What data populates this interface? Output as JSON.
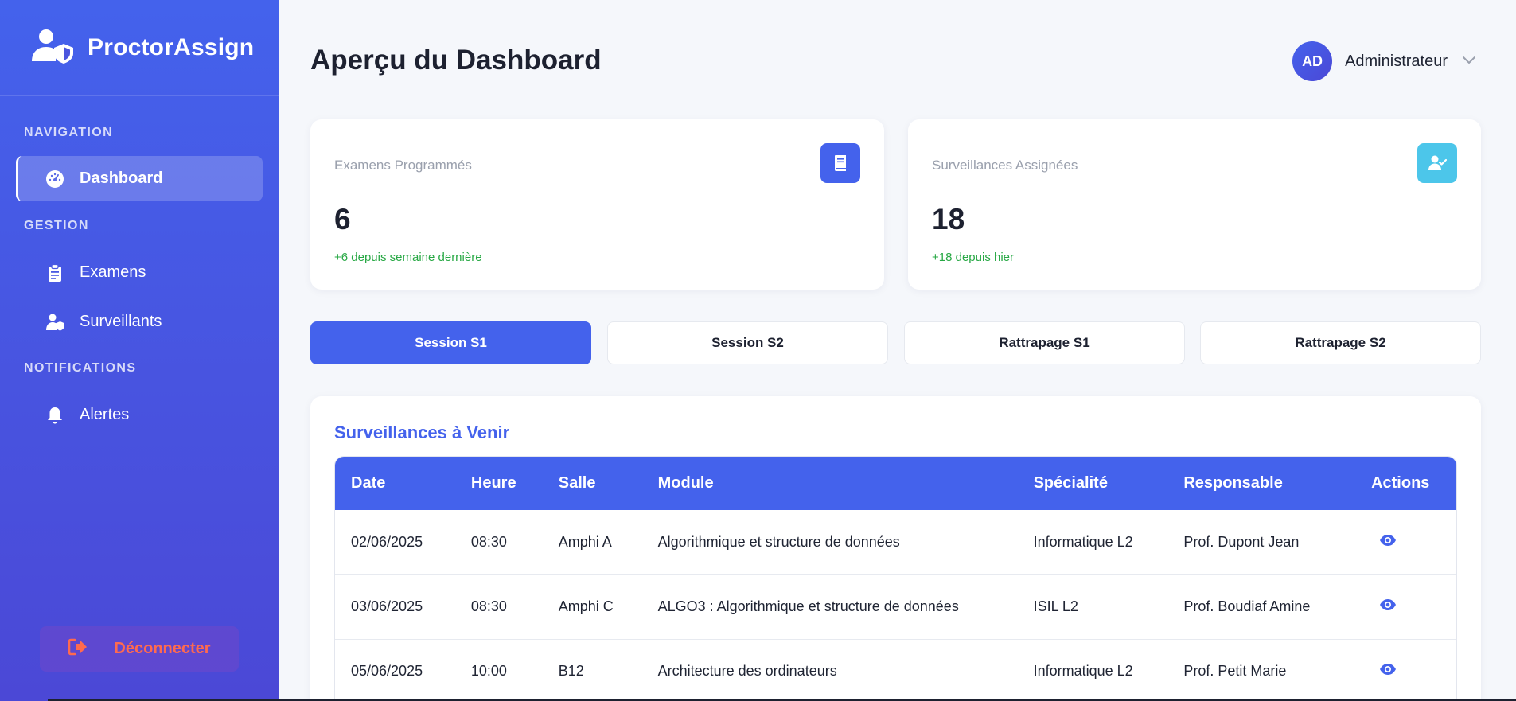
{
  "sidebar": {
    "brand": "ProctorAssign",
    "sections": {
      "navigation": "NAVIGATION",
      "gestion": "GESTION",
      "notifications": "NOTIFICATIONS"
    },
    "items": {
      "dashboard": "Dashboard",
      "examens": "Examens",
      "surveillants": "Surveillants",
      "alertes": "Alertes"
    },
    "logout": "Déconnecter"
  },
  "header": {
    "title": "Aperçu du Dashboard",
    "user_initials": "AD",
    "user_name": "Administrateur"
  },
  "stats": [
    {
      "label": "Examens Programmés",
      "value": "6",
      "delta": "+6 depuis semaine dernière",
      "icon": "book-icon",
      "color": "#4462ec"
    },
    {
      "label": "Surveillances Assignées",
      "value": "18",
      "delta": "+18 depuis hier",
      "icon": "user-check-icon",
      "color": "#4cc6ea"
    }
  ],
  "tabs": [
    "Session S1",
    "Session S2",
    "Rattrapage S1",
    "Rattrapage S2"
  ],
  "active_tab": "Session S1",
  "panel": {
    "title": "Surveillances à Venir",
    "columns": [
      "Date",
      "Heure",
      "Salle",
      "Module",
      "Spécialité",
      "Responsable",
      "Actions"
    ],
    "rows": [
      {
        "date": "02/06/2025",
        "heure": "08:30",
        "salle": "Amphi A",
        "module": "Algorithmique et structure de données",
        "specialite": "Informatique L2",
        "responsable": "Prof. Dupont Jean"
      },
      {
        "date": "03/06/2025",
        "heure": "08:30",
        "salle": "Amphi C",
        "module": "ALGO3 : Algorithmique et structure de données",
        "specialite": "ISIL L2",
        "responsable": "Prof. Boudiaf Amine"
      },
      {
        "date": "05/06/2025",
        "heure": "10:00",
        "salle": "B12",
        "module": "Architecture des ordinateurs",
        "specialite": "Informatique L2",
        "responsable": "Prof. Petit Marie"
      }
    ]
  },
  "colors": {
    "primary": "#4462ec",
    "accent": "#4cc6ea",
    "success": "#27a844",
    "danger": "#ff6a4f"
  }
}
